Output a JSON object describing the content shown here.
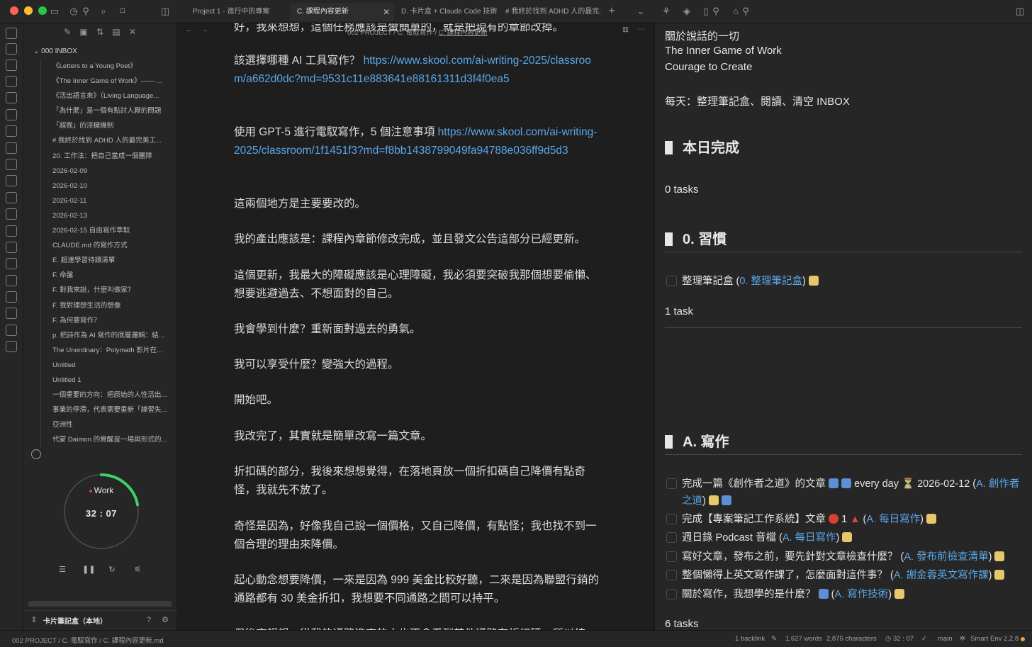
{
  "tabs": [
    {
      "label": "Project 1 - 進行中的專案"
    },
    {
      "label": "C. 課程內容更新"
    },
    {
      "label": "D. 卡片盒 + Claude Code 技術"
    },
    {
      "label": "# 我終於找到 ADHD 人的最完..."
    }
  ],
  "sidebar": {
    "folder": "000 INBOX",
    "files": [
      "《Letters to a Young Poet》",
      "《The Inner Game of Work》—— ...",
      "《活出語言來》（Living Language...",
      "「為什麼」是一個有點討人厭的問題",
      "「超我」的淫穢機制",
      "# 我終於找到 ADHD 人的最完美工...",
      "20. 工作法：把自己當成一個團隊",
      "2026-02-09",
      "2026-02-10",
      "2026-02-11",
      "2026-02-13",
      "2026-02-15 自由寫作萃取",
      "CLAUDE.md 的寫作方式",
      "E. 超速學習待讀清單",
      "F. 命盤",
      "F. 對我來說，什麼叫做家？",
      "F. 我對理想生活的想像",
      "F. 為何要寫作？",
      "p. 把詩作為 AI 寫作的底層邏輯：結...",
      "The Unordinary：Polymath 影片在...",
      "Untitled",
      "Untitled 1",
      "一個重要的方向：把原始的人性活出...",
      "事業的停滯，代表需要重新「練習失...",
      "亞洲性",
      "代蒙 Daimon 的覺醒是一場與形式的..."
    ],
    "timer": {
      "mode": "Work",
      "time": "32 : 07",
      "progress": 0.22
    },
    "vault_name": "卡片筆記盒（本地）"
  },
  "editor": {
    "breadcrumb": [
      "002 PROJECT",
      "C. 電馭寫作",
      "C. 課程內容更新"
    ],
    "paragraphs": [
      {
        "type": "text",
        "text": "好，我來想想，這個任務應該是蠻簡單的，就是把現有的章節改掉。"
      },
      {
        "type": "link",
        "text": "該選擇哪種 AI 工具寫作？ ",
        "link": "https://www.skool.com/ai-writing-2025/classroom/a662d0dc?md=9531c11e883641e88161311d3f4f0ea5"
      },
      {
        "type": "link",
        "text": "使用 GPT-5 進行電馭寫作，5 個注意事項 ",
        "link": "https://www.skool.com/ai-writing-2025/classroom/1f1451f3?md=f8bb1438799049fa94788e036ff9d5d3"
      },
      {
        "type": "text",
        "text": "這兩個地方是主要要改的。"
      },
      {
        "type": "text",
        "text": "我的產出應該是：課程內章節修改完成，並且發文公告這部分已經更新。"
      },
      {
        "type": "text",
        "text": "這個更新，我最大的障礙應該是心理障礙，我必須要突破我那個想要偷懶、想要逃避過去、不想面對的自己。"
      },
      {
        "type": "text",
        "text": "我會學到什麼？重新面對過去的勇氣。"
      },
      {
        "type": "text",
        "text": "我可以享受什麼？變強大的過程。"
      },
      {
        "type": "text",
        "text": "開始吧。"
      },
      {
        "type": "text",
        "text": "我改完了，其實就是簡單改寫一篇文章。"
      },
      {
        "type": "text",
        "text": "折扣碼的部分，我後來想想覺得，在落地頁放一個折扣碼自己降價有點奇怪，我就先不放了。"
      },
      {
        "type": "text",
        "text": "奇怪是因為，好像我自己說一個價格，又自己降價，有點怪；我也找不到一個合理的理由來降價。"
      },
      {
        "type": "text",
        "text": "起心動念想要降價，一來是因為 999 美金比較好聽，二來是因為聯盟行銷的通路都有 30 美金折扣，我想要不同通路之間可以持平。"
      },
      {
        "type": "text",
        "text": "但後來想想，從我的通路進來的人也不會看到其他通路有折扣碼，所以統"
      }
    ]
  },
  "right_pane": {
    "intro_lines": [
      "關於說話的一切",
      "The Inner Game of Work",
      "Courage to Create",
      "每天：整理筆記盒、閱讀、清空 INBOX"
    ],
    "sections": [
      {
        "heading": "本日完成",
        "count": "0 tasks",
        "tasks": []
      },
      {
        "heading": "0. 習慣",
        "count": "1 task",
        "tasks": [
          {
            "text": "整理筆記盒 (",
            "link": "0. 整理筆記盒",
            "tail": ")"
          }
        ]
      },
      {
        "heading": "A. 寫作",
        "count": "6 tasks",
        "tasks": [
          {
            "text": "完成一篇《創作者之道》的文章 ",
            "extra": "every day ⏳ 2026-02-12 (",
            "link": "A. 創作者之道",
            "tail": ")"
          },
          {
            "text": "完成【專案筆記工作系統】文章 ",
            "extra": "1 ",
            "link": "A. 每日寫作",
            "tail": ")"
          },
          {
            "text": "週日錄 Podcast 音檔 (",
            "link": "A. 每日寫作",
            "tail": ")"
          },
          {
            "text": "寫好文章，發布之前，要先針對文章檢查什麼？ (",
            "link": "A. 發布前檢查清單",
            "tail": ")"
          },
          {
            "text": "整個懶得上英文寫作課了，怎麼面對這件事？ (",
            "link": "A. 謝金蓉英文寫作課",
            "tail": ")"
          },
          {
            "text": "關於寫作，我想學的是什麼？ ",
            "extra": "(",
            "link": "A. 寫作技術",
            "tail": ")"
          }
        ]
      }
    ]
  },
  "statusbar": {
    "path": "002 PROJECT / C. 電馭寫作 / C. 課程內容更新.md",
    "backlinks": "1 backlink",
    "words": "1,627 words",
    "characters": "2,875 characters",
    "timer": "32 : 07",
    "branch": "main",
    "plugin": "Smart Env 2.2.8"
  },
  "colors": {
    "accent": "#5ba7e8",
    "timer_ring": "#3ecf6a",
    "background": "#1e1e1e",
    "panel": "#262626"
  }
}
